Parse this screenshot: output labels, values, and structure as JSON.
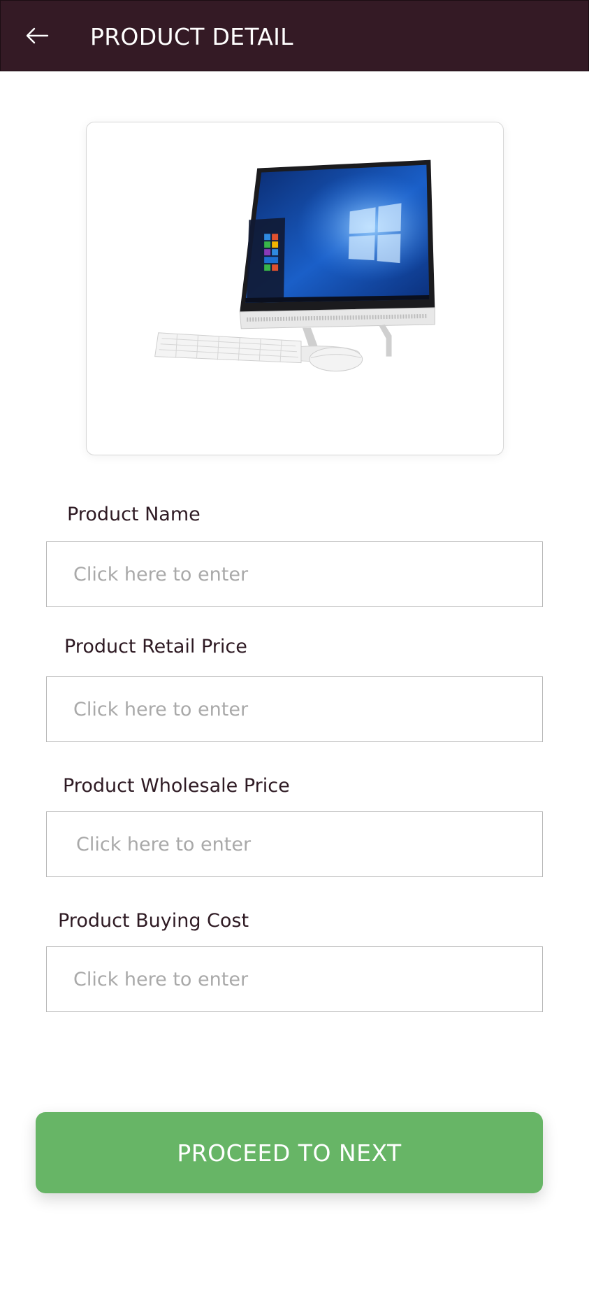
{
  "header": {
    "title": "PRODUCT DETAIL",
    "back_icon": "arrow-left-icon",
    "background_color": "#341a25"
  },
  "product_image": {
    "subject": "all-in-one-desktop-computer"
  },
  "form": {
    "fields": [
      {
        "label": "Product Name",
        "placeholder": "Click here to enter",
        "value": ""
      },
      {
        "label": "Product Retail Price",
        "placeholder": "Click here to enter",
        "value": ""
      },
      {
        "label": "Product Wholesale Price",
        "placeholder": "Click here to enter",
        "value": ""
      },
      {
        "label": "Product Buying Cost",
        "placeholder": "Click here to enter",
        "value": ""
      }
    ]
  },
  "actions": {
    "proceed_label": "PROCEED TO NEXT",
    "proceed_color": "#67b566"
  }
}
